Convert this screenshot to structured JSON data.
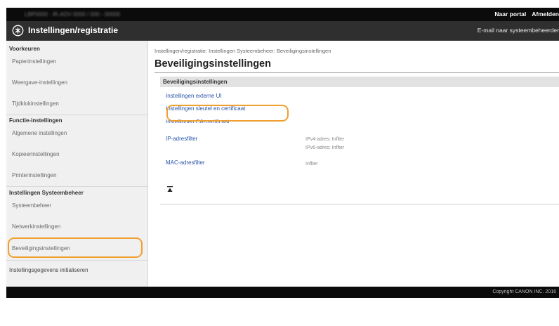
{
  "topbar": {
    "device_text": "LBP0000 · iR-ADV 0000 / 000 - 00000",
    "links": [
      "Naar portal",
      "Afmelden"
    ]
  },
  "header": {
    "title": "Instellingen/registratie",
    "mail_link": "E-mail naar systeembeheerder"
  },
  "sidebar": {
    "groups": [
      {
        "heading": "Voorkeuren",
        "items": [
          "Papierinstellingen",
          "Weergave-instellingen",
          "Tijdklokinstellingen"
        ]
      },
      {
        "heading": "Functie-instellingen",
        "items": [
          "Algemene instellingen",
          "Kopieerinstellingen",
          "Printerinstellingen"
        ]
      },
      {
        "heading": "Instellingen Systeembeheer",
        "items": [
          "Systeembeheer",
          "Netwerkinstellingen",
          "Beveiligingsinstellingen"
        ]
      }
    ],
    "last_item": "Instellingsgegevens initialiseren"
  },
  "main": {
    "breadcrumb": "Instellingen/registratie: Instellingen Systeembeheer: Beveiligingsinstellingen",
    "page_title": "Beveiligingsinstellingen",
    "section_title": "Beveiligingsinstellingen",
    "links": {
      "remote_ui": "Instellingen externe UI",
      "key_cert": "Instellingen sleutel en certificaat",
      "ca_cert": "Instellingen CA-certificaat",
      "ip_filter": "IP-adresfilter",
      "mac_filter": "MAC-adresfilter"
    },
    "values": {
      "ipv4": "IPv4-adres: Inflter",
      "ipv6": "IPv6-adres: Inflter",
      "mac": "Inflter"
    }
  },
  "footer": {
    "copyright": "Copyright CANON INC. 2016"
  },
  "colors": {
    "highlight": "#f0a030",
    "link": "#2a55a8",
    "topbar": "#0b0b0b",
    "titlebar": "#2f2f2f"
  },
  "icons": {
    "logo": "gear-logo-icon",
    "totop": "back-to-top-icon"
  }
}
